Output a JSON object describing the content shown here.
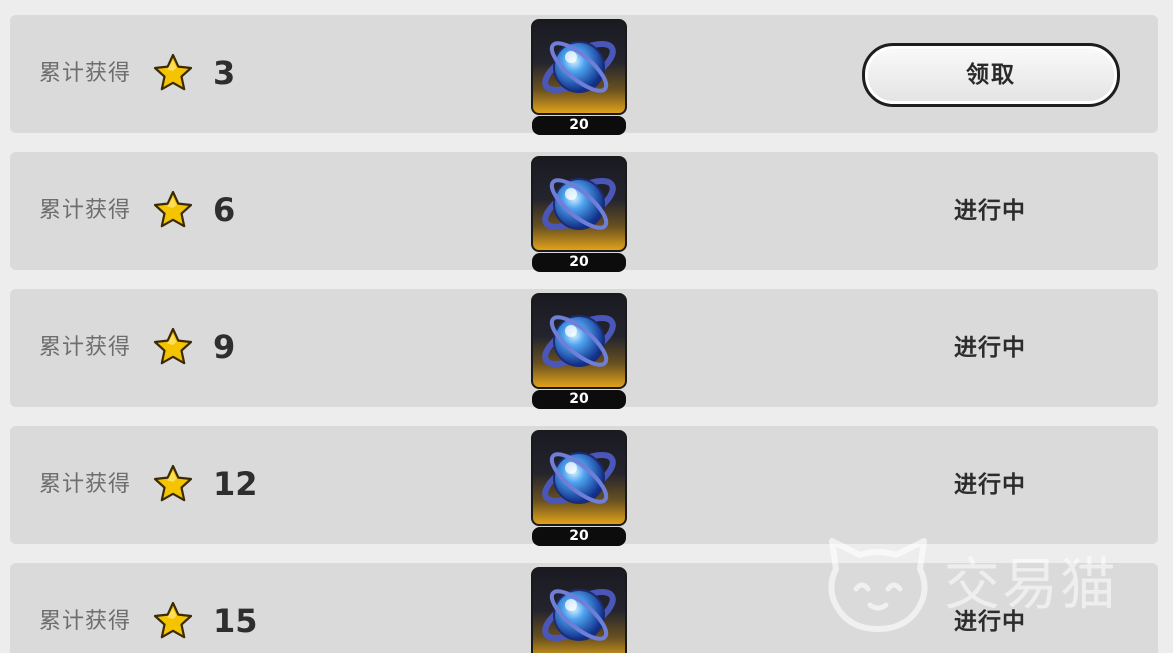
{
  "rows": [
    {
      "label": "累计获得",
      "count": "3",
      "reward_qty": "20",
      "action": "领取",
      "action_type": "claim"
    },
    {
      "label": "累计获得",
      "count": "6",
      "reward_qty": "20",
      "action": "进行中",
      "action_type": "status"
    },
    {
      "label": "累计获得",
      "count": "9",
      "reward_qty": "20",
      "action": "进行中",
      "action_type": "status"
    },
    {
      "label": "累计获得",
      "count": "12",
      "reward_qty": "20",
      "action": "进行中",
      "action_type": "status"
    },
    {
      "label": "累计获得",
      "count": "15",
      "reward_qty": "",
      "action": "进行中",
      "action_type": "status"
    }
  ],
  "icons": {
    "star": "star-icon",
    "reward": "blue-orb-item-icon",
    "watermark": "cat-logo-icon"
  },
  "watermark": {
    "text": "交易猫"
  },
  "colors": {
    "background": "#ededed",
    "row": "#dadada",
    "star": "#f5c400",
    "tile_bottom": "#e0a21a",
    "orb": "#3c8ee8"
  }
}
